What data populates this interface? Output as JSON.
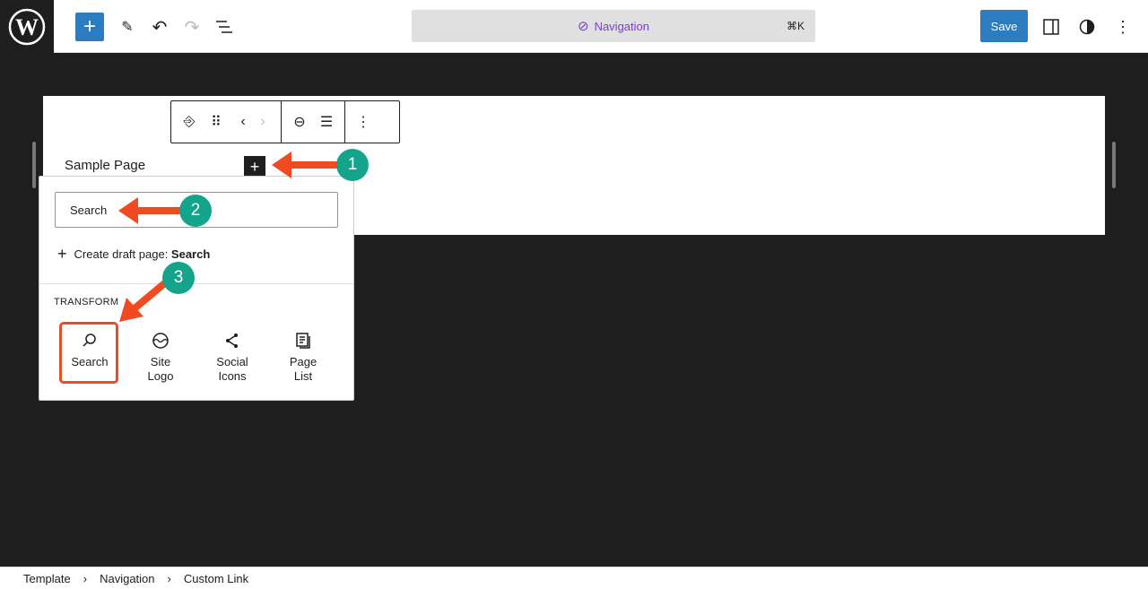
{
  "topbar": {
    "command_label": "Navigation",
    "shortcut": "⌘K",
    "save_label": "Save"
  },
  "canvas": {
    "menu_item": "Sample Page"
  },
  "popover": {
    "search_value": "Search",
    "create_prefix": "Create draft page: ",
    "create_term": "Search",
    "transform_label": "TRANSFORM",
    "items": [
      {
        "label": "Search",
        "icon": "search-icon"
      },
      {
        "label": "Site Logo",
        "icon": "site-logo-icon"
      },
      {
        "label": "Social Icons",
        "icon": "share-icon"
      },
      {
        "label": "Page List",
        "icon": "page-list-icon"
      }
    ]
  },
  "annotations": [
    "1",
    "2",
    "3"
  ],
  "annotation_colors": {
    "arrow": "#f04a23",
    "badge": "#14a38b"
  },
  "breadcrumb": [
    "Template",
    "Navigation",
    "Custom Link"
  ]
}
